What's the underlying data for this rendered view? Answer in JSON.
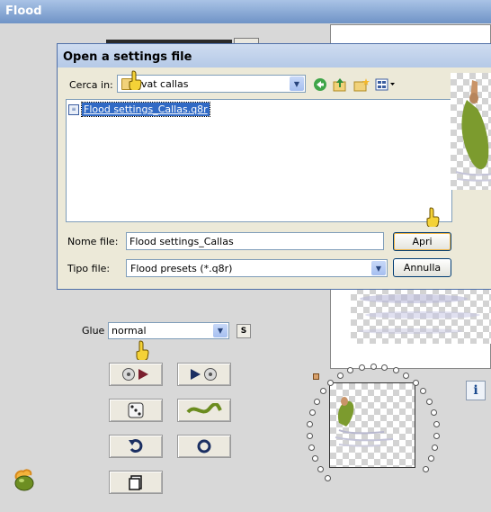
{
  "window": {
    "title": "Flood"
  },
  "glue": {
    "label": "Glue",
    "value": "normal",
    "side_button": "S"
  },
  "tool_buttons": [
    {
      "name": "load-preset-button",
      "icon": "disc-play-icon"
    },
    {
      "name": "save-preset-button",
      "icon": "play-disc-icon"
    },
    {
      "name": "random-button",
      "icon": "dice-icon"
    },
    {
      "name": "wave-button",
      "icon": "wave-icon"
    },
    {
      "name": "undo-button",
      "icon": "undo-arrow-icon"
    },
    {
      "name": "reset-button",
      "icon": "circle-icon"
    },
    {
      "name": "copy-button",
      "icon": "clipboard-icon"
    }
  ],
  "info_button": {
    "label": "i"
  },
  "dialog": {
    "title": "Open a settings file",
    "look_in_label": "Cerca in:",
    "look_in_value": "vat callas",
    "files": [
      {
        "name": "Flood settings_Callas.q8r",
        "selected": true
      }
    ],
    "filename_label": "Nome file:",
    "filename_value": "Flood settings_Callas",
    "filetype_label": "Tipo file:",
    "filetype_value": "Flood presets (*.q8r)",
    "open_button": "Apri",
    "cancel_button": "Annulla"
  },
  "colors": {
    "selection": "#316ac5",
    "title_gradient": "#6f93c6",
    "figure_green": "#7c9b2e"
  }
}
